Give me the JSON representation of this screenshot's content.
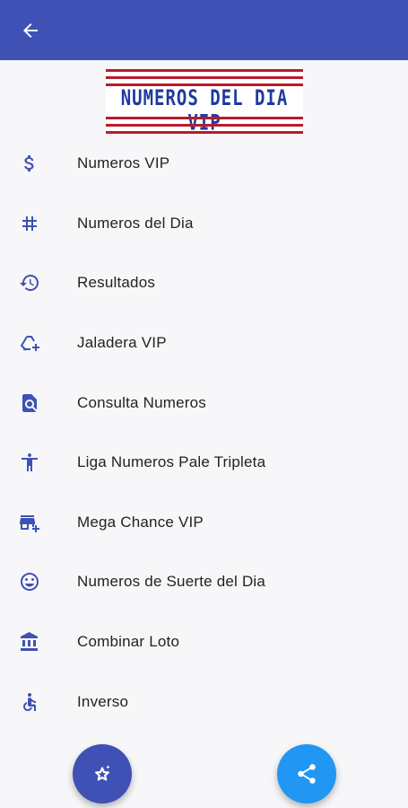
{
  "header": {
    "back_icon": "arrow-left-icon",
    "color": "#3f51b5"
  },
  "logo": {
    "text": "NUMEROS DEL DIA VIP",
    "text_color": "#1e3a9e",
    "stripe_color": "#b71c2c"
  },
  "menu": {
    "icon_color": "#3f51b5",
    "items": [
      {
        "label": "Numeros VIP",
        "icon": "dollar-icon"
      },
      {
        "label": "Numeros del Dia",
        "icon": "hashtag-icon"
      },
      {
        "label": "Resultados",
        "icon": "history-icon"
      },
      {
        "label": "Jaladera VIP",
        "icon": "recycle-add-icon"
      },
      {
        "label": "Consulta Numeros",
        "icon": "find-in-page-icon"
      },
      {
        "label": "Liga Numeros Pale Tripleta",
        "icon": "accessibility-icon"
      },
      {
        "label": "Mega Chance VIP",
        "icon": "add-business-icon"
      },
      {
        "label": "Numeros de Suerte del Dia",
        "icon": "smiley-icon"
      },
      {
        "label": "Combinar Loto",
        "icon": "bank-icon"
      },
      {
        "label": "Inverso",
        "icon": "accessible-icon"
      }
    ]
  },
  "fabs": {
    "rate": {
      "icon": "star-sparkle-icon",
      "color": "#3f51b5"
    },
    "share": {
      "icon": "share-icon",
      "color": "#2196f3"
    }
  }
}
